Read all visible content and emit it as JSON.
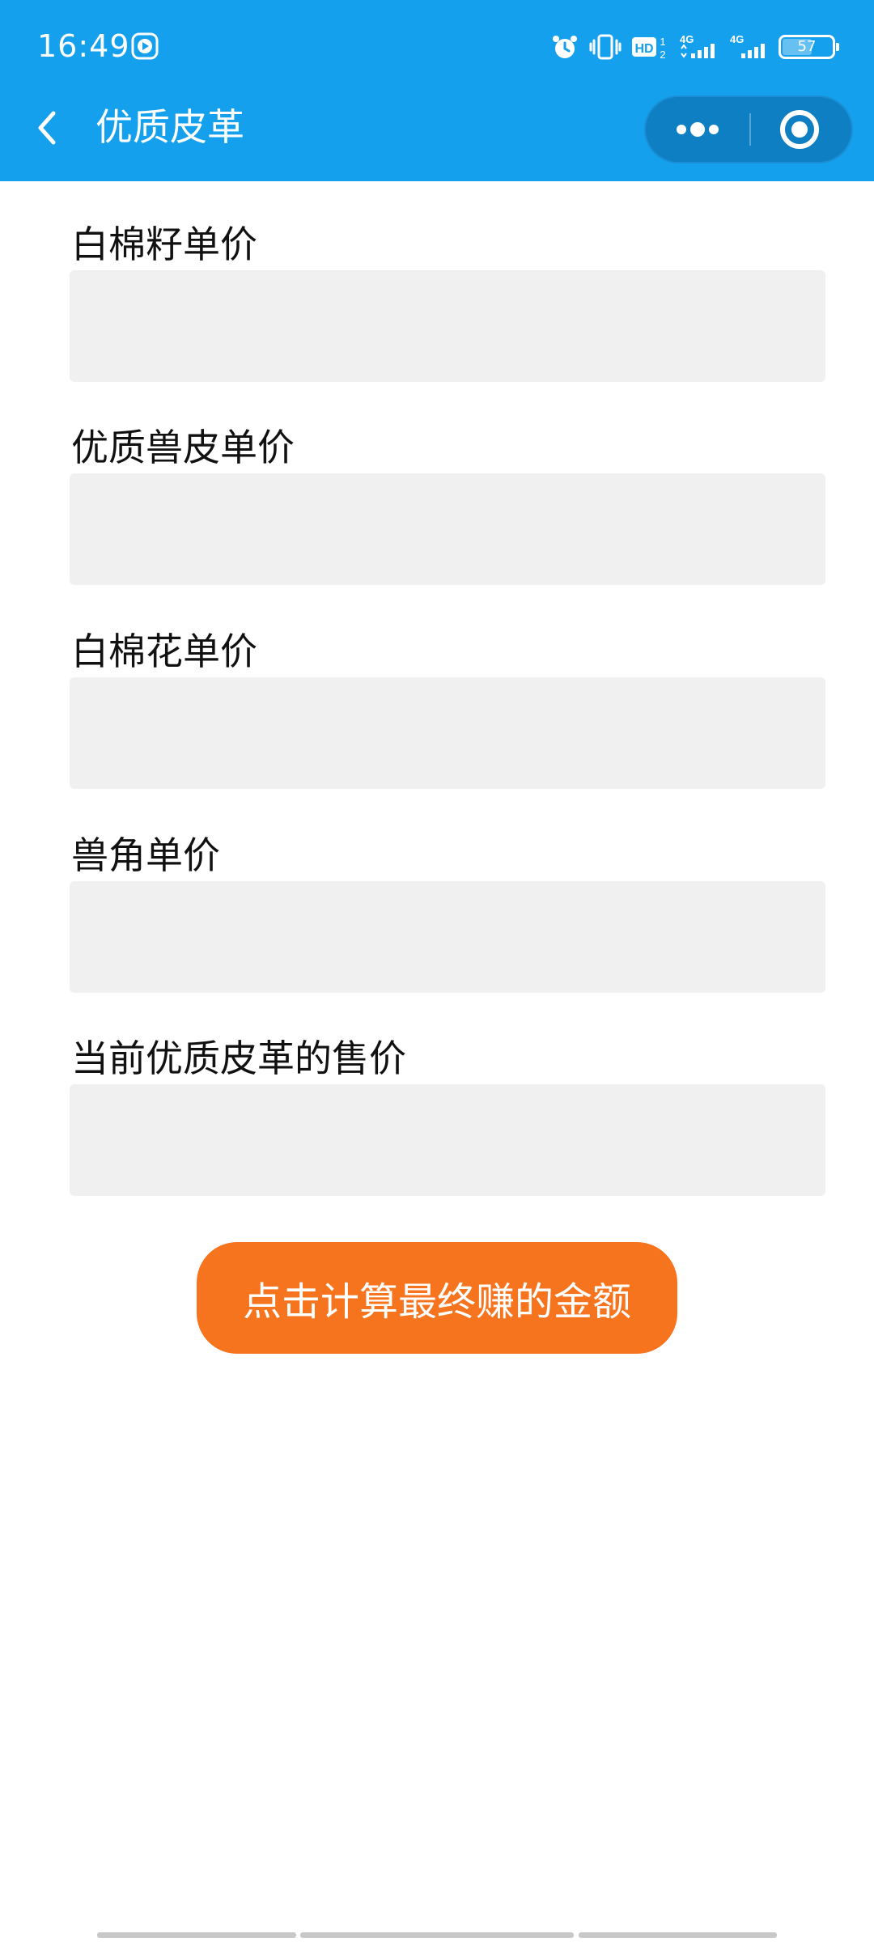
{
  "status_bar": {
    "time": "16:49",
    "battery": "57",
    "hd_label": "HD",
    "net_label_1": "4G",
    "net_label_2": "4G"
  },
  "nav": {
    "title": "优质皮革"
  },
  "form": {
    "fields": [
      {
        "label": "白棉籽单价",
        "value": "",
        "placeholder": ""
      },
      {
        "label": "优质兽皮单价",
        "value": "",
        "placeholder": ""
      },
      {
        "label": "白棉花单价",
        "value": "",
        "placeholder": ""
      },
      {
        "label": "兽角单价",
        "value": "",
        "placeholder": ""
      },
      {
        "label": "当前优质皮革的售价",
        "value": "",
        "placeholder": ""
      }
    ],
    "submit_label": "点击计算最终赚的金额"
  },
  "colors": {
    "header": "#14a0ec",
    "button": "#f7741f",
    "input_bg": "#f0f0f0"
  },
  "icons": {
    "back": "chevron-left-icon",
    "more": "more-dots-icon",
    "close": "target-circle-icon",
    "alarm": "alarm-icon",
    "vibrate": "vibrate-icon",
    "signal": "signal-icon",
    "battery": "battery-icon",
    "media": "play-icon"
  }
}
